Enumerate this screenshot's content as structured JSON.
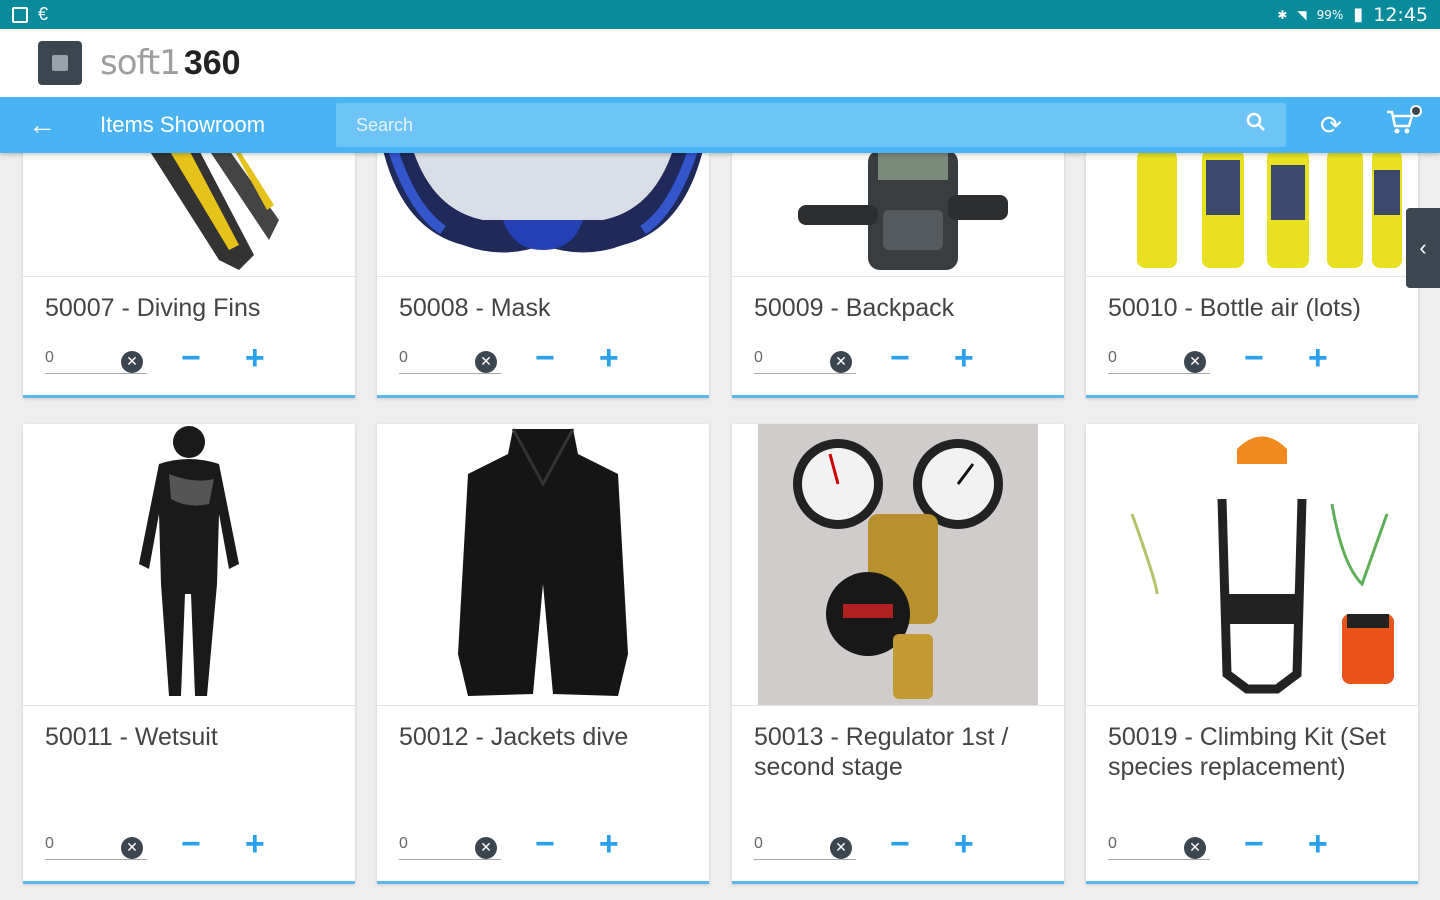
{
  "status_bar": {
    "time": "12:45",
    "battery": "99%"
  },
  "header": {
    "brand_light": "soft1",
    "brand_bold": "360"
  },
  "toolbar": {
    "back_icon": "arrow-left-icon",
    "title": "Items Showroom",
    "search_placeholder": "Search",
    "search_value": "",
    "refresh_icon": "refresh-icon",
    "cart_icon": "cart-icon"
  },
  "accent_color": "#4ab3f4",
  "items": [
    {
      "title": "50007 - Diving Fins",
      "qty": "0"
    },
    {
      "title": "50008 - Mask",
      "qty": "0"
    },
    {
      "title": "50009 - Backpack",
      "qty": "0"
    },
    {
      "title": "50010 - Bottle air (lots)",
      "qty": "0"
    },
    {
      "title": "50011 - Wetsuit",
      "qty": "0"
    },
    {
      "title": "50012 - Jackets dive",
      "qty": "0"
    },
    {
      "title": "50013 - Regulator 1st / second stage",
      "qty": "0"
    },
    {
      "title": "50019 - Climbing Kit (Set species replacement)",
      "qty": "0"
    }
  ]
}
